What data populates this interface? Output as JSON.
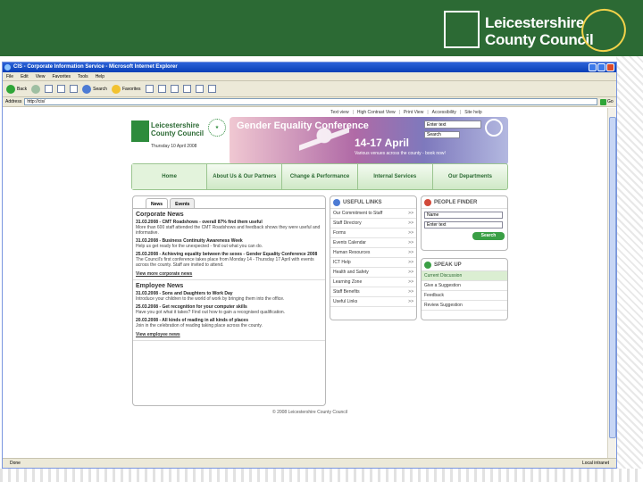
{
  "slide": {
    "org_line1": "Leicestershire",
    "org_line2": "County Council",
    "seal_text": "Excellent"
  },
  "browser": {
    "window_title": "CIS - Corporate Information Service - Microsoft Internet Explorer",
    "menu": [
      "File",
      "Edit",
      "View",
      "Favorites",
      "Tools",
      "Help"
    ],
    "toolbar": {
      "back": "Back",
      "search": "Search",
      "favorites": "Favorites"
    },
    "address_label": "Address",
    "address_value": "http://cis/",
    "go_label": "Go",
    "status_left": "Done",
    "status_zone": "Local intranet"
  },
  "site": {
    "top_links": [
      "Text view",
      "High Contrast View",
      "Print View",
      "Accessibility",
      "Site help"
    ],
    "logo_line1": "Leicestershire",
    "logo_line2": "County Council",
    "date": "Thursday 10 April 2008",
    "banner": {
      "title": "Gender Equality Conference",
      "dates": "14-17 April",
      "sub": "Various venues across the county - book now!"
    },
    "search_placeholder": "Enter text",
    "search_scope": "Search",
    "nav": [
      "Home",
      "About Us & Our Partners",
      "Change & Performance",
      "Internal Services",
      "Our Departments"
    ]
  },
  "news": {
    "tabs": [
      "News",
      "Events"
    ],
    "corporate_heading": "Corporate News",
    "corporate_items": [
      {
        "title": "31.03.2008 - CMT Roadshows - overall 87% find them useful",
        "desc": "More than 600 staff attended the CMT Roadshows and feedback shows they were useful and informative."
      },
      {
        "title": "31.03.2008 - Business Continuity Awareness Week",
        "desc": "Help us get ready for the unexpected - find out what you can do."
      },
      {
        "title": "25.03.2008 - Achieving equality between the sexes - Gender Equality Conference 2008",
        "desc": "The Council's first conference takes place from Monday 14 - Thursday 17 April with events across the county. Staff are invited to attend."
      }
    ],
    "corporate_more": "View more corporate news",
    "employee_heading": "Employee News",
    "employee_items": [
      {
        "title": "31.03.2008 - Sons and Daughters to Work Day",
        "desc": "Introduce your children to the world of work by bringing them into the office."
      },
      {
        "title": "25.03.2008 - Get recognition for your computer skills",
        "desc": "Have you got what it takes? Find out how to gain a recognised qualification."
      },
      {
        "title": "20.03.2008 - All kinds of reading in all kinds of places",
        "desc": "Join in the celebration of reading taking place across the county."
      }
    ],
    "employee_more": "View employee news"
  },
  "useful_links": {
    "title": "USEFUL LINKS",
    "items": [
      "Our Commitment to Staff",
      "Staff Directory",
      "Forms",
      "Events Calendar",
      "Human Resources",
      "ICT Help",
      "Health and Safety",
      "Learning Zone",
      "Staff Benefits",
      "Useful Links"
    ]
  },
  "people_finder": {
    "title": "PEOPLE FINDER",
    "select_value": "Name",
    "input_value": "Enter text",
    "button": "Search"
  },
  "speak_up": {
    "title": "SPEAK UP",
    "items": [
      "Current Discussion",
      "Give a Suggestion",
      "Feedback",
      "Review Suggestion"
    ]
  },
  "footer": "© 2008 Leicestershire County Council"
}
